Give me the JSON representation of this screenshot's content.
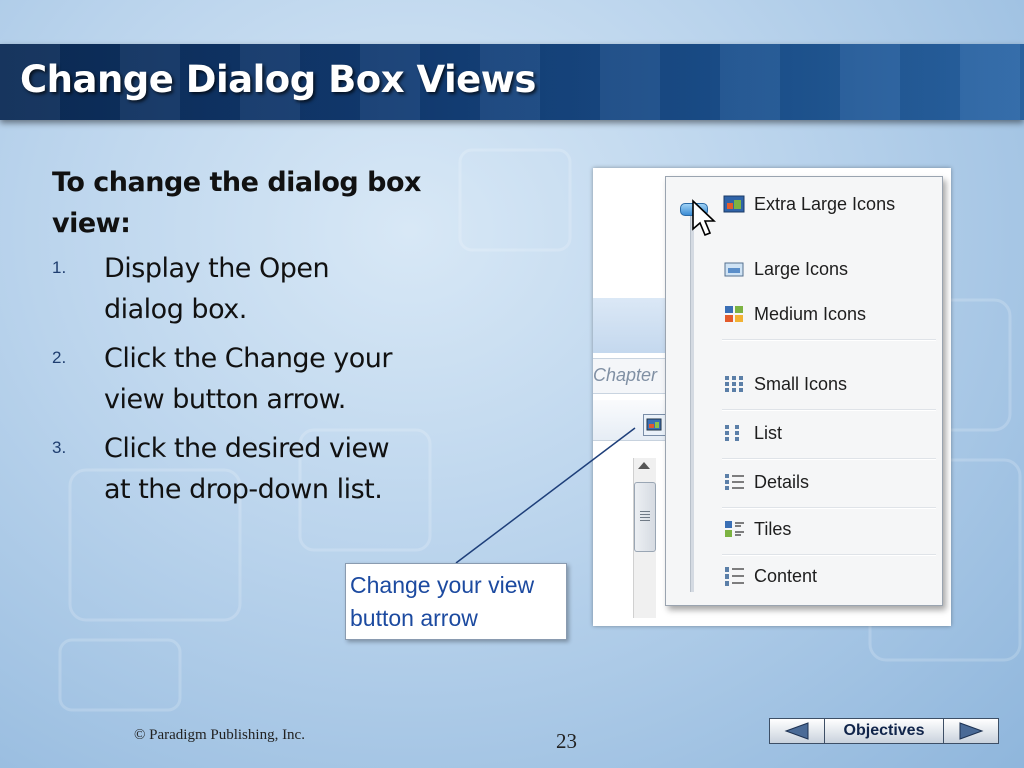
{
  "slide": {
    "title": "Change Dialog Box Views",
    "intro": "To change the dialog box view:",
    "steps": [
      {
        "num": "1.",
        "text": "Display the Open dialog box."
      },
      {
        "num": "2.",
        "text": "Click the Change your view button arrow."
      },
      {
        "num": "3.",
        "text": "Click the desired view at the drop-down list."
      }
    ]
  },
  "screenshot": {
    "address_fragment": "Chapter",
    "menu_items": [
      {
        "label": "Extra Large Icons",
        "icon": "extra-large-icons-icon"
      },
      {
        "label": "Large Icons",
        "icon": "large-icons-icon"
      },
      {
        "label": "Medium Icons",
        "icon": "medium-icons-icon"
      },
      {
        "label": "Small Icons",
        "icon": "small-icons-icon"
      },
      {
        "label": "List",
        "icon": "list-view-icon"
      },
      {
        "label": "Details",
        "icon": "details-view-icon"
      },
      {
        "label": "Tiles",
        "icon": "tiles-view-icon"
      },
      {
        "label": "Content",
        "icon": "content-view-icon"
      }
    ]
  },
  "callout": {
    "line1": "Change your view",
    "line2": "button arrow"
  },
  "footer": {
    "copyright": "© Paradigm Publishing, Inc.",
    "page_number": "23",
    "objectives_label": "Objectives"
  },
  "colors": {
    "title_bar": "#123c74",
    "callout_text": "#1c4aa0",
    "step_number": "#1f3e70"
  }
}
